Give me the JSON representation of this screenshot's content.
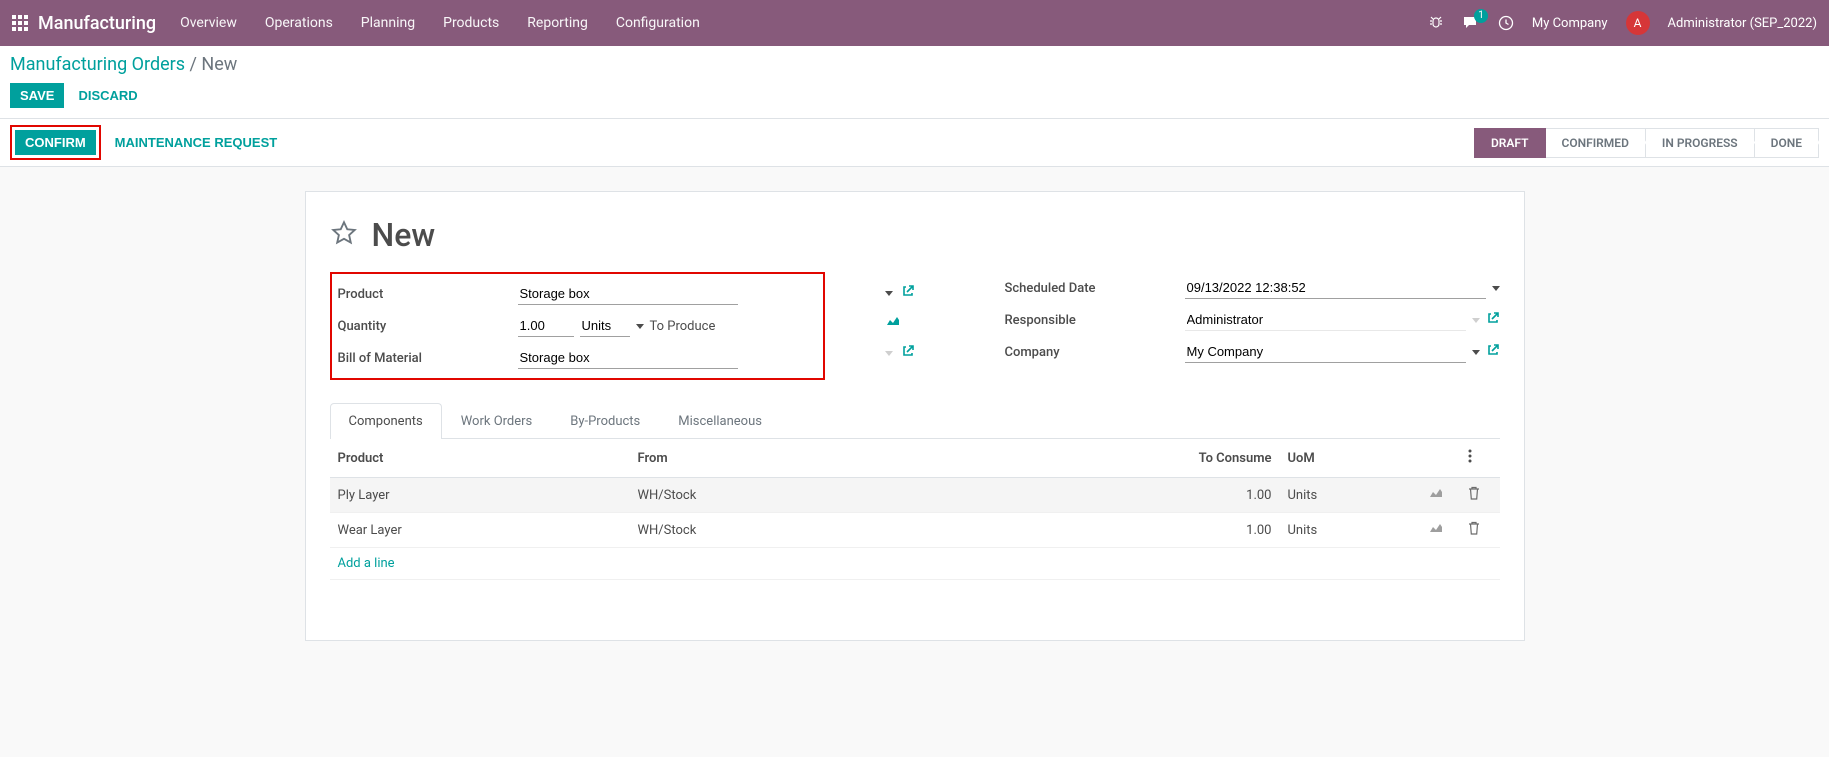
{
  "topbar": {
    "app_name": "Manufacturing",
    "nav": [
      "Overview",
      "Operations",
      "Planning",
      "Products",
      "Reporting",
      "Configuration"
    ],
    "messages_count": "1",
    "company": "My Company",
    "avatar_letter": "A",
    "username": "Administrator (SEP_2022)"
  },
  "breadcrumb": {
    "root": "Manufacturing Orders",
    "sep": "/",
    "current": "New",
    "save": "SAVE",
    "discard": "DISCARD"
  },
  "actions": {
    "confirm": "CONFIRM",
    "maintenance": "MAINTENANCE REQUEST"
  },
  "status": [
    "DRAFT",
    "CONFIRMED",
    "IN PROGRESS",
    "DONE"
  ],
  "title": "New",
  "form": {
    "left": {
      "product_label": "Product",
      "product_value": "Storage box",
      "quantity_label": "Quantity",
      "quantity_value": "1.00",
      "quantity_unit": "Units",
      "to_produce": "To Produce",
      "bom_label": "Bill of Material",
      "bom_value": "Storage box"
    },
    "right": {
      "sched_label": "Scheduled Date",
      "sched_value": "09/13/2022 12:38:52",
      "resp_label": "Responsible",
      "resp_value": "Administrator",
      "company_label": "Company",
      "company_value": "My Company"
    }
  },
  "tabs": [
    "Components",
    "Work Orders",
    "By-Products",
    "Miscellaneous"
  ],
  "table": {
    "headers": {
      "product": "Product",
      "from": "From",
      "to_consume": "To Consume",
      "uom": "UoM"
    },
    "rows": [
      {
        "product": "Ply Layer",
        "from": "WH/Stock",
        "to_consume": "1.00",
        "uom": "Units"
      },
      {
        "product": "Wear Layer",
        "from": "WH/Stock",
        "to_consume": "1.00",
        "uom": "Units"
      }
    ],
    "add_line": "Add a line"
  }
}
